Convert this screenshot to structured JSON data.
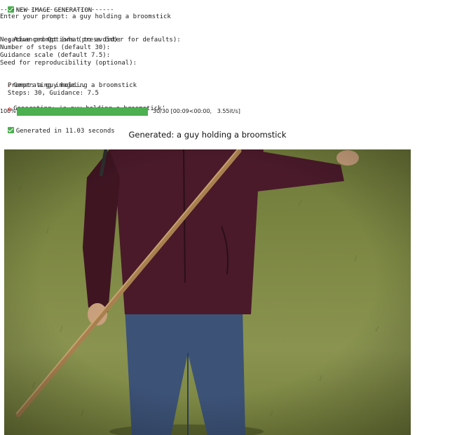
{
  "console": {
    "header": "NEW IMAGE GENERATION",
    "divider": "------------------------------",
    "prompt_line": "Enter your prompt: a guy holding a broomstick",
    "advanced_header": "Advanced Options (press Enter for defaults):",
    "negative_prompt": "Negative prompt (what to avoid):",
    "steps_prompt": "Number of steps (default 30):",
    "guidance_prompt": "Guidance scale (default 7.5):",
    "seed_prompt": "Seed for reproducibility (optional):",
    "generating": "Generating image...",
    "prompt_echo": "  Prompt: a guy holding a broomstick",
    "settings_echo": "  Steps: 30, Guidance: 7.5",
    "generating_quote": "Generating: 'a guy holding a broomstick'",
    "done": "Generated in 11.03 seconds"
  },
  "progress": {
    "percent_label": "100%",
    "fraction": 1.0,
    "stats": "30/30 [00:09<00:00,   3.55it/s]"
  },
  "result": {
    "title": "Generated: a guy holding a broomstick"
  },
  "colors": {
    "progress_fill": "#4caf50",
    "progress_track": "#e0e0e0"
  },
  "icons": {
    "header": "check-icon",
    "advanced": "gear-icon",
    "generating": "rocket-icon",
    "generating_quote": "art-icon",
    "done": "check-icon"
  }
}
